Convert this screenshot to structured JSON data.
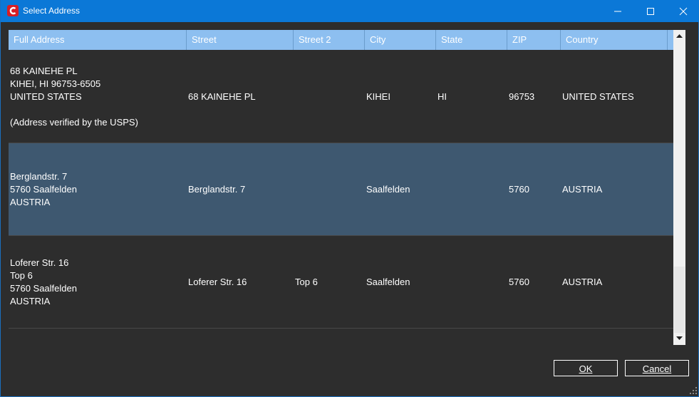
{
  "window": {
    "title": "Select Address",
    "accent_color": "#0b78d7",
    "app_icon": "c-logo-icon"
  },
  "grid": {
    "columns": [
      {
        "label": "Full Address"
      },
      {
        "label": "Street"
      },
      {
        "label": "Street 2"
      },
      {
        "label": "City"
      },
      {
        "label": "State"
      },
      {
        "label": "ZIP"
      },
      {
        "label": "Country"
      }
    ],
    "header_color": "#8dbff0",
    "selected_color": "#3e5870",
    "rows": [
      {
        "full_address": [
          "68 KAINEHE PL",
          "KIHEI, HI 96753-6505",
          "UNITED STATES",
          "",
          "(Address verified by the USPS)"
        ],
        "street": "68 KAINEHE PL",
        "street2": "",
        "city": "KIHEI",
        "state": "HI",
        "zip": "96753",
        "country": "UNITED STATES",
        "selected": false
      },
      {
        "full_address": [
          "Berglandstr. 7",
          "5760 Saalfelden",
          "AUSTRIA"
        ],
        "street": "Berglandstr. 7",
        "street2": "",
        "city": "Saalfelden",
        "state": "",
        "zip": "5760",
        "country": "AUSTRIA",
        "selected": true
      },
      {
        "full_address": [
          "Loferer Str. 16",
          "Top 6",
          "5760 Saalfelden",
          "AUSTRIA"
        ],
        "street": "Loferer Str. 16",
        "street2": "Top 6",
        "city": "Saalfelden",
        "state": "",
        "zip": "5760",
        "country": "AUSTRIA",
        "selected": false
      }
    ]
  },
  "buttons": {
    "ok_label": "OK",
    "cancel_label": "Cancel"
  }
}
